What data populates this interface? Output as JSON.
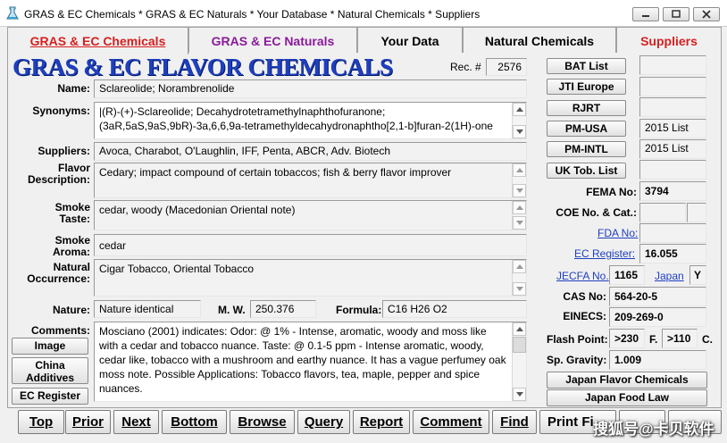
{
  "window": {
    "title": "GRAS & EC Chemicals * GRAS & EC Naturals * Your Database * Natural Chemicals * Suppliers"
  },
  "tabs": [
    {
      "label": "GRAS & EC Chemicals",
      "color": "#d61f1f",
      "active": true
    },
    {
      "label": "GRAS & EC Naturals",
      "color": "#8a1a9a",
      "active": false
    },
    {
      "label": "Your Data",
      "color": "#000000",
      "active": false
    },
    {
      "label": "Natural Chemicals",
      "color": "#000000",
      "active": false
    },
    {
      "label": "Suppliers",
      "color": "#d61f1f",
      "active": false
    }
  ],
  "header": {
    "title": "GRAS & EC FLAVOR CHEMICALS",
    "rec_label": "Rec. #",
    "rec_value": "2576"
  },
  "fields": {
    "name_label": "Name:",
    "name": "Sclareolide; Norambrenolide",
    "synonyms_label": "Synonyms:",
    "synonyms": "|(R)-(+)-Sclareolide; Decahydrotetramethylnaphthofuranone; (3aR,5aS,9aS,9bR)-3a,6,6,9a-tetramethyldecahydronaphtho[2,1-b]furan-2(1H)-one",
    "suppliers_label": "Suppliers:",
    "suppliers": "Avoca, Charabot, O'Laughlin, IFF, Penta, ABCR, Adv. Biotech",
    "flavor_label_1": "Flavor",
    "flavor_label_2": "Description:",
    "flavor": "Cedary; impact compound of certain tobaccos; fish & berry  flavor improver",
    "smoke_taste_label_1": "Smoke",
    "smoke_taste_label_2": "Taste:",
    "smoke_taste": "cedar, woody (Macedonian Oriental note)",
    "smoke_aroma_label_1": "Smoke",
    "smoke_aroma_label_2": "Aroma:",
    "smoke_aroma": "cedar",
    "natural_label_1": "Natural",
    "natural_label_2": "Occurrence:",
    "natural": "Cigar Tobacco, Oriental Tobacco",
    "nature_label": "Nature:",
    "nature": "Nature identical",
    "mw_label": "M. W.",
    "mw": "250.376",
    "formula_label": "Formula:",
    "formula": "C16 H26 O2",
    "comments_label": "Comments:",
    "comments": "Mosciano (2001) indicates: Odor: @ 1% - Intense, aromatic, woody and moss like with a cedar and tobacco nuance. Taste: @ 0.1-5 ppm - Intense aromatic, woody, cedar like, tobacco with a mushroom and earthy nuance. It has a vague perfumey oak moss note. Possible Applications: Tobacco flavors, tea, maple, pepper and spice nuances."
  },
  "left_buttons": {
    "image": "Image",
    "china_1": "China",
    "china_2": "Additives",
    "ec_register": "EC Register"
  },
  "right": {
    "bat_list": "BAT List",
    "bat_value": "",
    "jti_europe": "JTI Europe",
    "jti_value": "",
    "rjrt": "RJRT",
    "rjrt_value": "",
    "pm_usa": "PM-USA",
    "pm_usa_value": "2015 List",
    "pm_intl": "PM-INTL",
    "pm_intl_value": "2015 List",
    "uk_tob": "UK Tob. List",
    "uk_tob_value": "",
    "fema_label": "FEMA No:",
    "fema": "3794",
    "coe_label": "COE No. & Cat.:",
    "coe_no": "",
    "coe_cat": "",
    "fda_link": "FDA No:",
    "fda": "",
    "ec_link": "EC Register:",
    "ec": "16.055",
    "jecfa_link": "JECFA No.",
    "jecfa": "1165",
    "japan_link": "Japan",
    "japan": "Y",
    "cas_label": "CAS No:",
    "cas": "564-20-5",
    "einecs_label": "EINECS:",
    "einecs": "209-269-0",
    "flash_label": "Flash Point:",
    "flash_f": ">230",
    "f_unit": "F.",
    "flash_c": ">110",
    "c_unit": "C.",
    "sg_label": "Sp. Gravity:",
    "sg": "1.009",
    "japan_flavor": "Japan Flavor Chemicals",
    "japan_food": "Japan Food Law"
  },
  "nav": {
    "top": "Top",
    "prior": "Prior",
    "next": "Next",
    "bottom": "Bottom",
    "browse": "Browse",
    "query": "Query",
    "report": "Report",
    "comment": "Comment",
    "find": "Find",
    "print": "Print Fi"
  },
  "watermark": "搜狐号@卡贝软件"
}
